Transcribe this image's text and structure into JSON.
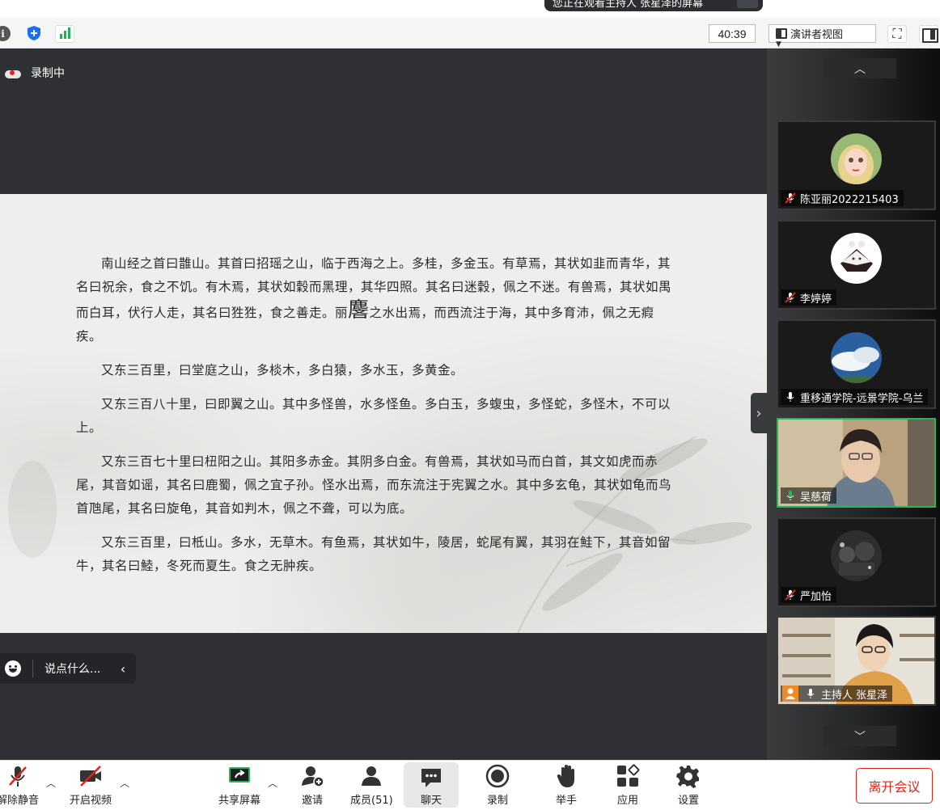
{
  "banner": {
    "viewing_text": "您正在观看主持人 张星泽的屏幕"
  },
  "topbar": {
    "info_icon": "info-icon",
    "shield_icon": "shield-icon",
    "signal_icon": "signal-bars-icon",
    "timer": "40:39",
    "view_mode": "演讲者视图"
  },
  "stage": {
    "recording_label": "录制中",
    "document": {
      "paragraphs": [
        {
          "before": "南山经之首曰䧿山。其首曰招瑶之山，临于西海之上。多桂，多金玉。有草焉，其状如韭而青华，其名曰祝余，食之不饥。有木焉，其状如穀而黑理，其华四照。其名曰迷穀，佩之不迷。有兽焉，其状如禺而白耳，伏行人走，其名曰狌狌，食之善走。丽",
          "big": "麐",
          "after": "之水出焉，而西流注于海，其中多育沛，佩之无瘕疾。"
        },
        {
          "before": "又东三百里，曰堂庭之山，多棪木，多白猿，多水玉，多黄金。",
          "big": "",
          "after": ""
        },
        {
          "before": "又东三百八十里，曰即翼之山。其中多怪兽，水多怪鱼。多白玉，多蝮虫，多怪蛇，多怪木，不可以上。",
          "big": "",
          "after": ""
        },
        {
          "before": "又东三百七十里曰杻阳之山。其阳多赤金。其阴多白金。有兽焉，其状如马而白首，其文如虎而赤尾，其音如谣，其名曰鹿蜀，佩之宜子孙。怪水出焉，而东流注于宪翼之水。其中多玄龟，其状如龟而鸟首虺尾，其名曰旋龟，其音如判木，佩之不聋，可以为底。",
          "big": "",
          "after": ""
        },
        {
          "before": "又东三百里，曰柢山。多水，无草木。有鱼焉，其状如牛，陵居，蛇尾有翼，其羽在鮭下，其音如留牛，其名曰鯥，冬死而夏生。食之无肿疾。",
          "big": "",
          "after": ""
        }
      ]
    },
    "chat_placeholder": "说点什么..."
  },
  "participants": [
    {
      "name": "陈亚丽2022215403",
      "muted": true,
      "avatar": "avatar-cartoon-girl"
    },
    {
      "name": "李婷婷",
      "muted": true,
      "avatar": "avatar-rabbit-cake"
    },
    {
      "name": "重移通学院-远景学院-乌兰",
      "muted": false,
      "avatar": "avatar-sky-cloud"
    },
    {
      "name": "吴慈荷",
      "muted": false,
      "speaking": true,
      "avatar": "video-woman-glasses"
    },
    {
      "name": "严加怡",
      "muted": true,
      "avatar": "avatar-dark-photo"
    },
    {
      "name": "主持人 张星泽",
      "muted": false,
      "host": true,
      "avatar": "video-host-room"
    }
  ],
  "toolbar": {
    "unmute": "解除静音",
    "start_video": "开启视频",
    "share_screen": "共享屏幕",
    "invite": "邀请",
    "members": "成员(51)",
    "chat": "聊天",
    "record": "录制",
    "raise_hand": "举手",
    "apps": "应用",
    "settings": "设置",
    "leave": "离开会议"
  },
  "colors": {
    "accent_green": "#2bb35a",
    "leave_red": "#e2231a",
    "brand_blue": "#1a6ef0"
  }
}
